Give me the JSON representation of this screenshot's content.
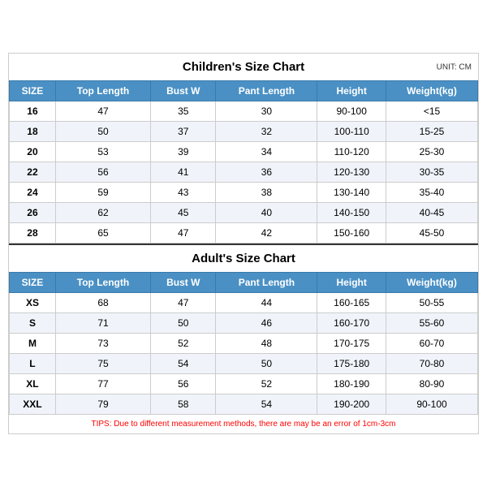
{
  "children_title": "Children's Size Chart",
  "adult_title": "Adult's Size Chart",
  "unit": "UNIT: CM",
  "tips": "TIPS: Due to different measurement methods, there are may be an error of 1cm-3cm",
  "headers": [
    "SIZE",
    "Top Length",
    "Bust W",
    "Pant Length",
    "Height",
    "Weight(kg)"
  ],
  "children_rows": [
    [
      "16",
      "47",
      "35",
      "30",
      "90-100",
      "<15"
    ],
    [
      "18",
      "50",
      "37",
      "32",
      "100-110",
      "15-25"
    ],
    [
      "20",
      "53",
      "39",
      "34",
      "110-120",
      "25-30"
    ],
    [
      "22",
      "56",
      "41",
      "36",
      "120-130",
      "30-35"
    ],
    [
      "24",
      "59",
      "43",
      "38",
      "130-140",
      "35-40"
    ],
    [
      "26",
      "62",
      "45",
      "40",
      "140-150",
      "40-45"
    ],
    [
      "28",
      "65",
      "47",
      "42",
      "150-160",
      "45-50"
    ]
  ],
  "adult_rows": [
    [
      "XS",
      "68",
      "47",
      "44",
      "160-165",
      "50-55"
    ],
    [
      "S",
      "71",
      "50",
      "46",
      "160-170",
      "55-60"
    ],
    [
      "M",
      "73",
      "52",
      "48",
      "170-175",
      "60-70"
    ],
    [
      "L",
      "75",
      "54",
      "50",
      "175-180",
      "70-80"
    ],
    [
      "XL",
      "77",
      "56",
      "52",
      "180-190",
      "80-90"
    ],
    [
      "XXL",
      "79",
      "58",
      "54",
      "190-200",
      "90-100"
    ]
  ]
}
